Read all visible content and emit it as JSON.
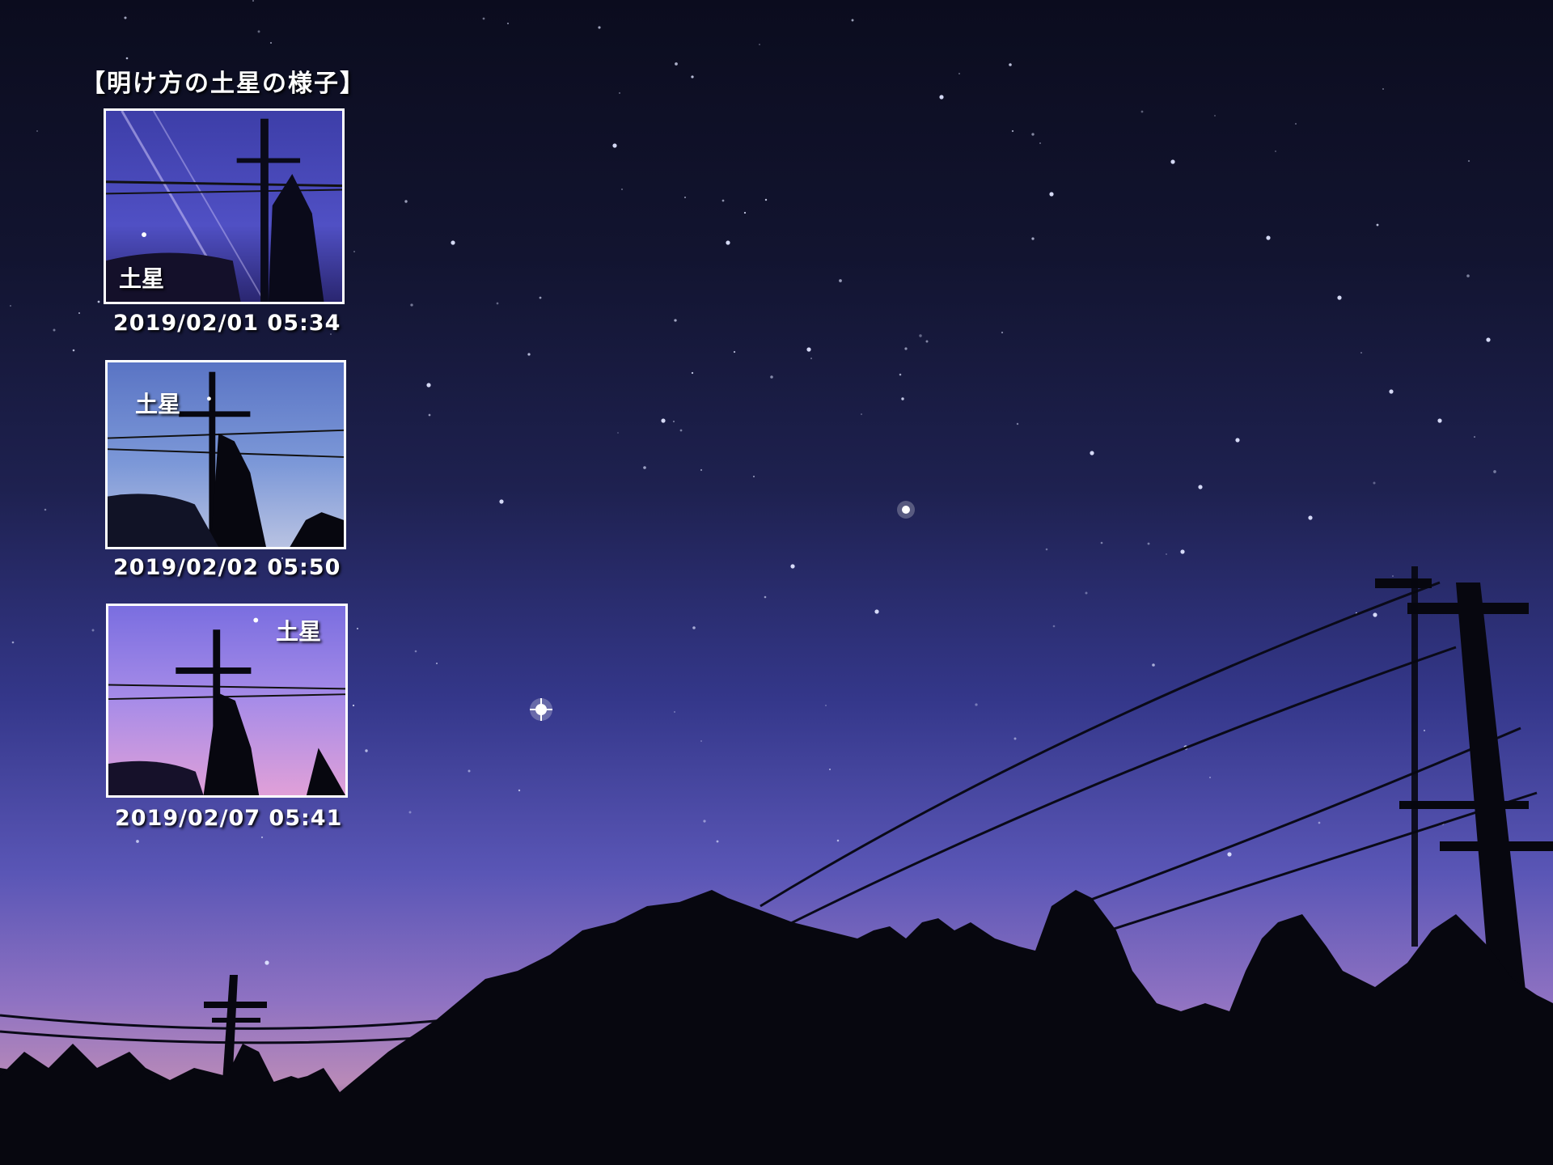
{
  "title": "【明け方の土星の様子】",
  "insets": [
    {
      "label": "土星",
      "caption": "2019/02/01 05:34"
    },
    {
      "label": "土星",
      "caption": "2019/02/02 05:50"
    },
    {
      "label": "土星",
      "caption": "2019/02/07 05:41"
    }
  ],
  "colors": {
    "sky_top": "#0b0c1e",
    "sky_horizon": "#b98ab8",
    "silhouette": "#07070f",
    "text": "#ffffff"
  }
}
